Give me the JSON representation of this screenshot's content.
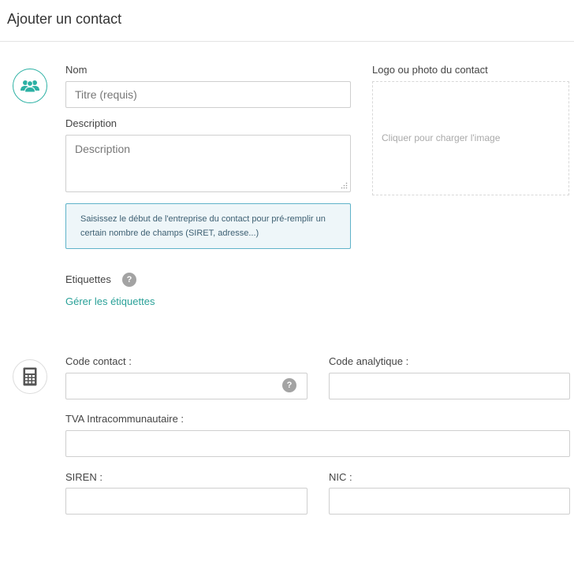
{
  "header": {
    "title": "Ajouter un contact"
  },
  "form": {
    "nom_label": "Nom",
    "nom_placeholder": "Titre (requis)",
    "description_label": "Description",
    "description_placeholder": "Description",
    "info_text": "Saisissez le début de l'entreprise du contact pour pré-remplir un certain nombre de champs (SIRET, adresse...)",
    "logo_label": "Logo ou photo du contact",
    "upload_hint": "Cliquer pour charger l'image",
    "etiquettes_label": "Etiquettes",
    "help_glyph": "?",
    "manage_tags_link": "Gérer les étiquettes"
  },
  "identifiers": {
    "code_contact_label": "Code contact :",
    "code_analytique_label": "Code analytique :",
    "tva_label": "TVA Intracommunautaire :",
    "siren_label": "SIREN :",
    "nic_label": "NIC :"
  },
  "icons": {
    "section_contact": "users-group-icon",
    "section_identifiers": "calculator-icon"
  },
  "colors": {
    "accent": "#2cb1a4",
    "info_border": "#5fb3c9",
    "info_background": "#eef6f9"
  }
}
